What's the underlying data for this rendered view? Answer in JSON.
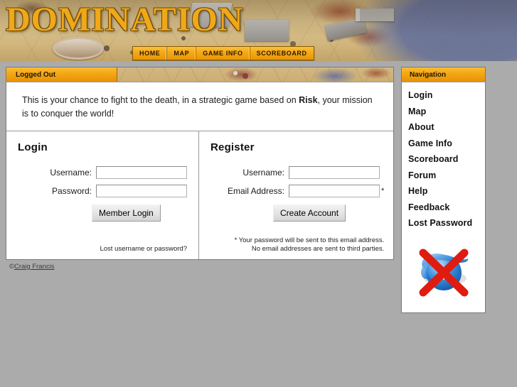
{
  "site": {
    "logo_text": "DOMINATION",
    "logo_color": "#f0a818"
  },
  "menubar": {
    "items": [
      {
        "label": "HOME"
      },
      {
        "label": "MAP"
      },
      {
        "label": "GAME INFO"
      },
      {
        "label": "SCOREBOARD"
      }
    ]
  },
  "content_panel": {
    "title": "Logged Out",
    "intro_part1": "This is your chance to fight to the death, in a strategic game based on ",
    "intro_bold": "Risk",
    "intro_part2": ", your mission is to conquer the world!"
  },
  "login": {
    "heading": "Login",
    "username_label": "Username:",
    "username_value": "",
    "password_label": "Password:",
    "password_value": "",
    "submit_label": "Member Login",
    "lost_link": "Lost username or password?"
  },
  "register": {
    "heading": "Register",
    "username_label": "Username:",
    "username_value": "",
    "email_label": "Email Address:",
    "email_value": "",
    "required_marker": "*",
    "submit_label": "Create Account",
    "note_line1": "* Your password will be sent to this email address.",
    "note_line2": "No email addresses are sent to third parties."
  },
  "footer": {
    "copyright_symbol": "©",
    "author": "Craig Francis"
  },
  "navigation": {
    "title": "Navigation",
    "items": [
      {
        "label": "Login"
      },
      {
        "label": "Map"
      },
      {
        "label": "About"
      },
      {
        "label": "Game Info"
      },
      {
        "label": "Scoreboard"
      },
      {
        "label": "Forum"
      },
      {
        "label": "Help"
      },
      {
        "label": "Feedback"
      },
      {
        "label": "Lost Password"
      }
    ],
    "badge_name": "no-internet-explorer-badge"
  },
  "colors": {
    "page_background": "#ababab",
    "accent_orange": "#f3a713",
    "panel_background": "#ffffff",
    "badge_cross": "#e01b10",
    "badge_blue": "#2b7fd4"
  }
}
